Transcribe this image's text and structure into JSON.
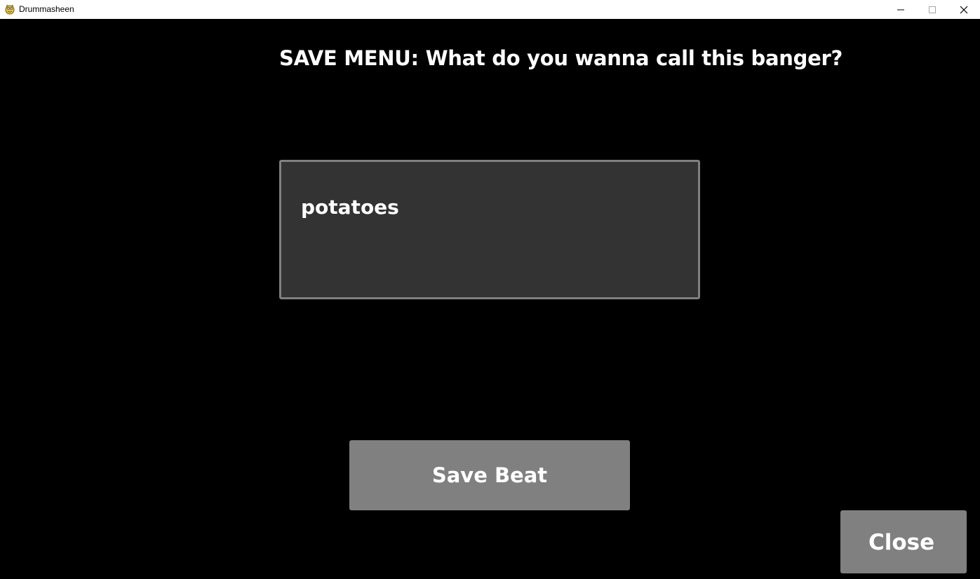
{
  "window": {
    "title": "Drummasheen",
    "icon": "pygame-snake-icon"
  },
  "main": {
    "heading": "SAVE MENU: What do you wanna call this banger?",
    "name_input": {
      "value": "potatoes"
    },
    "save_button_label": "Save Beat",
    "close_button_label": "Close"
  },
  "colors": {
    "background": "#000000",
    "input_background": "#333333",
    "input_border": "#808080",
    "button_background": "#808080",
    "text": "#ffffff"
  }
}
